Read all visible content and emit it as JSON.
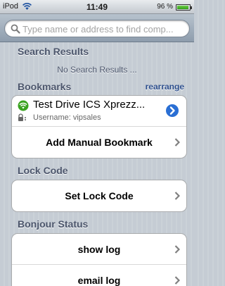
{
  "status_bar": {
    "carrier": "iPod",
    "time": "11:49",
    "battery_text": "96 %",
    "battery_level": 0.96
  },
  "search": {
    "placeholder": "Type name or address to find comp...",
    "value": ""
  },
  "sections": {
    "search_results": {
      "title": "Search Results",
      "empty_text": "No Search Results ..."
    },
    "bookmarks": {
      "title": "Bookmarks",
      "action_label": "rearrange",
      "items": [
        {
          "title": "Test Drive ICS Xprezz...",
          "subtitle": "Username: vipsales"
        }
      ],
      "add_label": "Add Manual Bookmark"
    },
    "lock_code": {
      "title": "Lock Code",
      "set_label": "Set Lock Code"
    },
    "bonjour_status": {
      "title": "Bonjour Status",
      "show_log_label": "show log",
      "email_log_label": "email log"
    }
  },
  "colors": {
    "background": "#c5ccd4",
    "section_text": "#4c566c",
    "link_blue": "#2d4f8d",
    "wifi_green": "#3aa320",
    "disclosure_blue": "#2a6fd4"
  },
  "icons": {
    "search": "search-icon",
    "wifi": "wifi-icon",
    "lock": "lock-icon",
    "disclosure": "detail-disclosure-icon",
    "chevron": "chevron-right-icon"
  }
}
